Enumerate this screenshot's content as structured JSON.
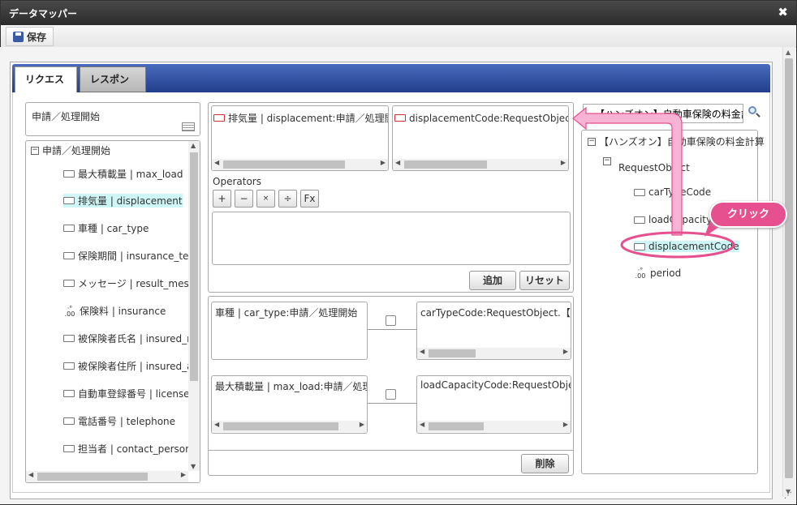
{
  "window": {
    "title": "データマッパー",
    "close_glyph": "✖"
  },
  "toolbar": {
    "save_label": "保存"
  },
  "tabs": [
    {
      "label": "リクエスト"
    },
    {
      "label": "レスポンス"
    }
  ],
  "left": {
    "header": "申請／処理開始",
    "root": "申請／処理開始",
    "items": [
      "最大積載量 | max_load",
      "排気量 | displacement",
      "車種 | car_type",
      "保険期間 | insurance_terr",
      "メッセージ | result_messag",
      "保険料 | insurance",
      "被保険者氏名 | insured_n",
      "被保険者住所 | insured_a",
      "自動車登録番号 | license_",
      "電話番号 | telephone",
      "担当者 | contact_personn"
    ]
  },
  "center": {
    "source_field": "排気量 | displacement:申請／処理開始",
    "target_field": "displacementCode:RequestObject.【ハ",
    "operators_label": "Operators",
    "operators": [
      "+",
      "−",
      "×",
      "÷",
      "Fx"
    ],
    "add_label": "追加",
    "reset_label": "リセット",
    "mappings": [
      {
        "source": "車種 | car_type:申請／処理開始",
        "target": "carTypeCode:RequestObject.【ハン"
      },
      {
        "source": "最大積載量 | max_load:申請／処理[",
        "target": "loadCapacityCode:RequestObject"
      }
    ],
    "delete_label": "削除"
  },
  "right": {
    "search_value": "【ハンズオン】自動車保険の料金計",
    "root": "【ハンズオン】自動車保険の料金計算",
    "node": "RequestObject",
    "items": [
      "carTypeCode",
      "loadCapacityCode",
      "displacementCode",
      "period"
    ]
  },
  "callout": {
    "label": "クリック"
  },
  "colors": {
    "accent": "#2a4a9c",
    "highlight": "#cef6f6",
    "callout": "#e6508f"
  }
}
